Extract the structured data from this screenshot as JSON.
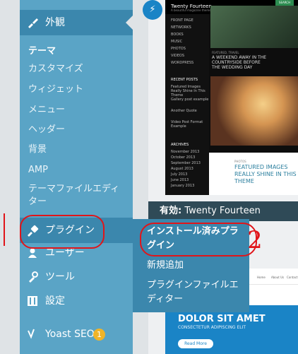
{
  "sidebar": {
    "appearance_label": "外観",
    "appearance_sub": [
      "テーマ",
      "カスタマイズ",
      "ウィジェット",
      "メニュー",
      "ヘッダー",
      "背景",
      "AMP",
      "テーマファイルエディター"
    ],
    "plugins_label": "プラグイン",
    "users_label": "ユーザー",
    "tools_label": "ツール",
    "settings_label": "設定",
    "yoast_label": "Yoast SEO",
    "yoast_count": "1"
  },
  "flyout": {
    "items": [
      "インストール済みプラグイン",
      "新規追加",
      "プラグインファイルエディター"
    ]
  },
  "themes": {
    "active_prefix": "有効:",
    "active_name": "Twenty Fourteen",
    "preview": {
      "site_title": "Twenty Fourteen",
      "tagline": "A beautiful magazine theme",
      "search_label": "SEARCH",
      "nav": [
        "FRONT PAGE",
        "NETWORKS",
        "BOOKS",
        "MUSIC",
        "PHOTOS",
        "VIDEOS",
        "WORDPRESS"
      ],
      "recent_heading": "RECENT POSTS",
      "recent_posts": [
        "Featured Images Really Shine In This Theme",
        "Gallery post example",
        "Another Quote",
        "Video Post Format Example"
      ],
      "archives_heading": "ARCHIVES",
      "archives": [
        "November 2013",
        "October 2013",
        "September 2013",
        "August 2013",
        "July 2013",
        "June 2013",
        "January 2013"
      ],
      "feature1_label": "FEATURED, TRAVEL",
      "feature1_title": "A WEEKEND AWAY IN THE COUNTRYSIDE BEFORE THE WEDDING DAY",
      "feature2_label": "PHOTOS",
      "feature2_title": "FEATURED IMAGES REALLY SHINE IN THIS THEME"
    },
    "preview2": {
      "headline": "DOLOR SIT AMET",
      "sub": "CONSECTETUR ADIPISCING ELIT",
      "button": "Read More",
      "nav": [
        "Home",
        "About Us",
        "Contact"
      ]
    }
  },
  "annotations": {
    "number": "2"
  },
  "colors": {
    "sidebar": "#5aa4c6",
    "sidebar_active": "#3b87ad",
    "annotation": "#e0151a",
    "badge": "#f0b429"
  }
}
